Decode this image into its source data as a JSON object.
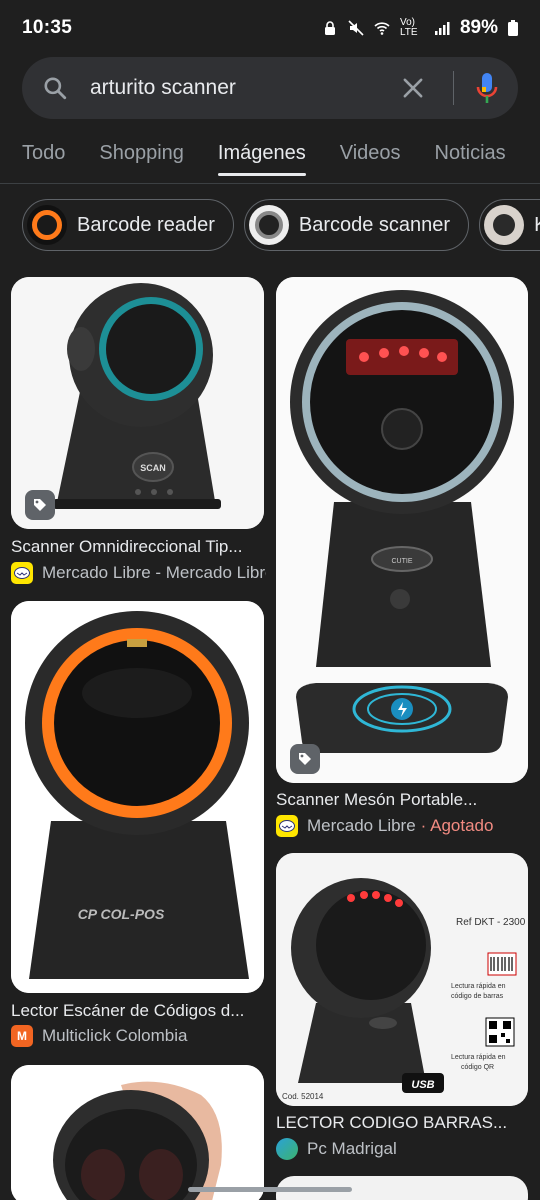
{
  "status": {
    "time": "10:35",
    "battery": "89%",
    "network": "Vo) LTE"
  },
  "search": {
    "query": "arturito scanner"
  },
  "tabs": [
    {
      "label": "Todo"
    },
    {
      "label": "Shopping"
    },
    {
      "label": "Imágenes"
    },
    {
      "label": "Videos"
    },
    {
      "label": "Noticias"
    }
  ],
  "active_tab": "Imágenes",
  "chips": [
    {
      "label": "Barcode reader"
    },
    {
      "label": "Barcode scanner"
    },
    {
      "label": "K"
    }
  ],
  "results": [
    {
      "title": "Scanner Omnidireccional Tip...",
      "source": "Mercado Libre - Mercado Libre",
      "product_text": "SCAN"
    },
    {
      "title": "Scanner Mesón Portable...",
      "source": "Mercado Libre",
      "status": "· Agotado",
      "product_text": "CUTIE"
    },
    {
      "title": "Lector Escáner de Códigos d...",
      "source": "Multiclick Colombia",
      "favicon_letter": "M",
      "product_text": "CP COL-POS"
    },
    {
      "title": "LECTOR CODIGO BARRAS...",
      "source": "Pc Madrigal",
      "product_text": {
        "ref": "Ref DKT - 2300",
        "line1": "Lectura rápida en",
        "line2": "código de barras",
        "line3": "Lectura rápida en",
        "line4": "código QR",
        "cod": "Cod. 52014",
        "usb": "USB"
      }
    },
    {
      "title": "",
      "source": ""
    }
  ],
  "colors": {
    "background": "#1f1f1f",
    "search_bg": "#303134",
    "accent_orange": "#ff7a1a",
    "sold_out": "#f28b82"
  },
  "icons": [
    "search-icon",
    "clear-icon",
    "mic-icon",
    "tag-icon"
  ]
}
